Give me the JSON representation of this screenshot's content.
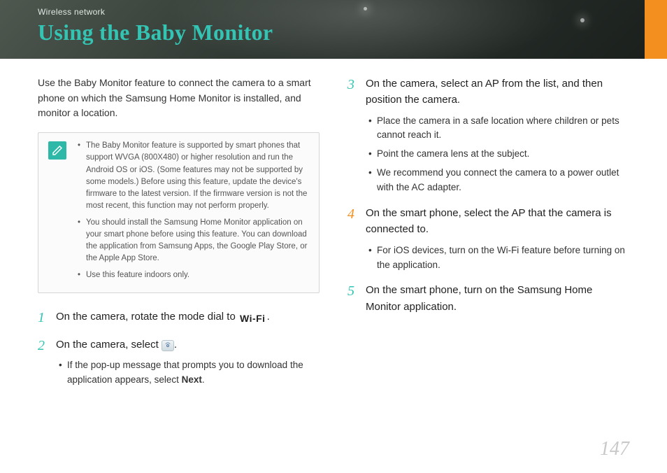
{
  "breadcrumb": "Wireless network",
  "title": "Using the Baby Monitor",
  "intro": "Use the Baby Monitor feature to connect the camera to a smart phone on which the Samsung Home Monitor is installed, and monitor a location.",
  "notes": [
    "The Baby Monitor feature is supported by smart phones that support WVGA (800X480) or higher resolution and run the Android OS or iOS. (Some features may not be supported by some models.) Before using this feature, update the device's firmware to the latest version. If the firmware version is not the most recent, this function may not perform properly.",
    "You should install the Samsung Home Monitor application on your smart phone before using this feature. You can download the application from Samsung Apps, the Google Play Store, or the Apple App Store.",
    "Use this feature indoors only."
  ],
  "steps_left": [
    {
      "num": "1",
      "text_pre": "On the camera, rotate the mode dial to ",
      "icon_label": "Wi-Fi",
      "text_post": "."
    },
    {
      "num": "2",
      "text_pre": "On the camera, select ",
      "icon": "monitor",
      "text_post": ".",
      "sub": [
        {
          "pre": "If the pop-up message that prompts you to download the application appears, select ",
          "bold": "Next",
          "post": "."
        }
      ]
    }
  ],
  "steps_right": [
    {
      "num": "3",
      "text": "On the camera, select an AP from the list, and then position the camera.",
      "sub": [
        "Place the camera in a safe location where children or pets cannot reach it.",
        "Point the camera lens at the subject.",
        "We recommend you connect the camera to a power outlet with the AC adapter."
      ]
    },
    {
      "num": "4",
      "text": "On the smart phone, select the AP that the camera is connected to.",
      "sub": [
        "For iOS devices, turn on the Wi-Fi feature before turning on the application."
      ]
    },
    {
      "num": "5",
      "text": "On the smart phone, turn on the Samsung Home Monitor application."
    }
  ],
  "page_number": "147"
}
